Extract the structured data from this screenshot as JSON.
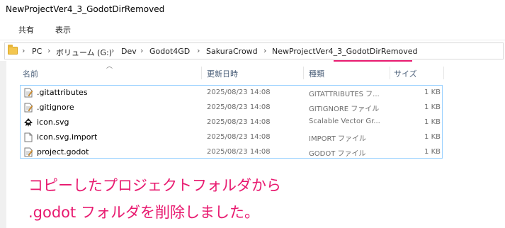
{
  "window": {
    "title": "NewProjectVer4_3_GodotDirRemoved"
  },
  "ribbon": {
    "tabs": [
      "共有",
      "表示"
    ]
  },
  "address": {
    "crumbs": [
      "PC",
      "ボリューム (G:)",
      "Dev",
      "Godot4GD",
      "SakuraCrowd",
      "NewProjectVer4_3_GodotDirRemoved"
    ],
    "separator": "›",
    "highlight_color": "#e8196f"
  },
  "columns": {
    "name": "名前",
    "date": "更新日時",
    "type": "種類",
    "size": "サイズ"
  },
  "files": [
    {
      "name": ".gitattributes",
      "date": "2025/08/23 14:08",
      "type": "GITATTRIBUTES フ...",
      "size": "1 KB",
      "icon": "text-file-icon"
    },
    {
      "name": ".gitignore",
      "date": "2025/08/23 14:08",
      "type": "GITIGNORE ファイル",
      "size": "1 KB",
      "icon": "text-file-icon"
    },
    {
      "name": "icon.svg",
      "date": "2025/08/23 14:08",
      "type": "Scalable Vector Gr...",
      "size": "1 KB",
      "icon": "inkscape-icon"
    },
    {
      "name": "icon.svg.import",
      "date": "2025/08/23 14:08",
      "type": "IMPORT ファイル",
      "size": "1 KB",
      "icon": "blank-file-icon"
    },
    {
      "name": "project.godot",
      "date": "2025/08/23 14:08",
      "type": "GODOT ファイル",
      "size": "1 KB",
      "icon": "text-file-icon"
    }
  ],
  "annotation": {
    "line1": "コピーしたプロジェクトフォルダから",
    "line2": ".godot フォルダを削除しました。",
    "color": "#e8196f"
  }
}
